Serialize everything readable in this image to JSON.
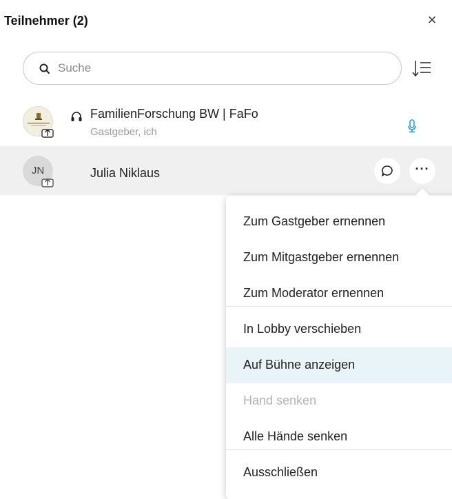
{
  "header": {
    "title": "Teilnehmer (2)",
    "close_label": "×"
  },
  "search": {
    "placeholder": "Suche",
    "value": ""
  },
  "participants": [
    {
      "name": "FamilienForschung BW | FaFo",
      "role": "Gastgeber, ich",
      "avatar": "logo",
      "icons": [
        "share-icon",
        "headset-icon",
        "microphone-icon"
      ]
    },
    {
      "name": "Julia Niklaus",
      "initials": "JN",
      "avatar": "initials",
      "icons": [
        "share-icon",
        "chat-icon",
        "more-icon"
      ]
    }
  ],
  "more_button_label": "···",
  "context_menu": {
    "items": [
      {
        "label": "Zum Gastgeber ernennen",
        "state": "normal"
      },
      {
        "label": "Zum Mitgastgeber ernennen",
        "state": "normal"
      },
      {
        "label": "Zum Moderator ernennen",
        "state": "normal"
      },
      {
        "label": "In Lobby verschieben",
        "state": "normal"
      },
      {
        "label": "Auf Bühne anzeigen",
        "state": "hover"
      },
      {
        "label": "Hand senken",
        "state": "disabled"
      },
      {
        "label": "Alle Hände senken",
        "state": "normal"
      },
      {
        "label": "Ausschließen",
        "state": "normal"
      }
    ]
  },
  "colors": {
    "accent": "#1aa1e6",
    "hover_row": "#f0f0f0",
    "menu_hover": "#e8f4f8",
    "disabled_text": "#b3b3b3"
  }
}
